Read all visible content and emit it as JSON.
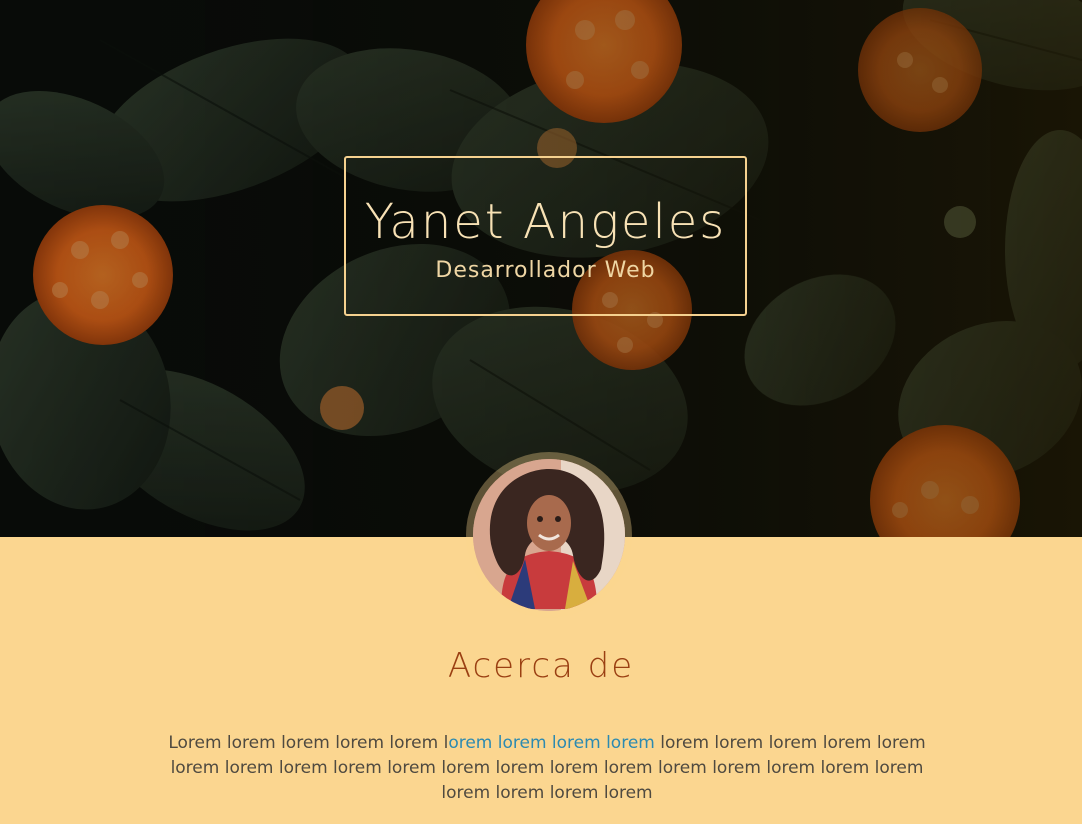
{
  "hero": {
    "name": "Yanet Angeles",
    "role": "Desarrollador Web"
  },
  "profile": {
    "avatar_label": "profile-photo"
  },
  "about": {
    "title": "Acerca de",
    "text_before": "Lorem lorem lorem lorem lorem l",
    "link_text": "orem lorem lorem lorem",
    "text_after": " lorem lorem lorem lorem lorem lorem lorem lorem lorem lorem lorem lorem lorem lorem lorem lorem lorem lorem lorem lorem lorem lorem lorem"
  },
  "colors": {
    "accent": "#fbd690",
    "title_color": "#9a3f12",
    "link_color": "#2c8ab1",
    "body_text": "#4f4a40"
  }
}
